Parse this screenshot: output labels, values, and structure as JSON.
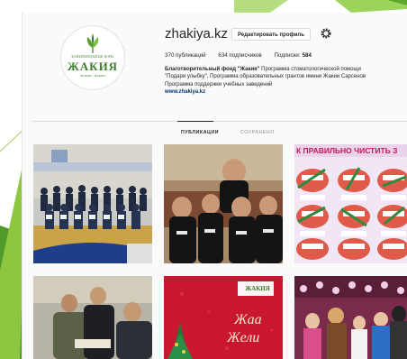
{
  "profile": {
    "username": "zhakiya.kz",
    "edit_button": "Редактировать профиль",
    "stats": {
      "posts": "370 публикаций",
      "followers": "634 подписчиков",
      "following_label": "Подписки:",
      "following_value": "584"
    },
    "bio": {
      "name": "Благотворительный фонд \"Жакия\"",
      "line1": "Программа стоматологической помощи",
      "line2": "\"Подари улыбку\", Программа образовательных грантов имени Жакии Сарсенов",
      "line3": "Программа поддержки учебных заведений",
      "website": "www.zhakiya.kz"
    },
    "logo": {
      "top_text": "ҚАЙЫРЫМДЫЛЫҚ ҚОРЫ",
      "main_text": "ЖАКИЯ",
      "bottom_text": "\"ЖАКИЯ\" \"ЖАҚИЯ\""
    }
  },
  "tabs": [
    {
      "label": "ПУБЛИКАЦИИ",
      "active": true
    },
    {
      "label": "СОХРАНЕНО",
      "active": false
    }
  ],
  "posts": [
    {
      "caption": ""
    },
    {
      "caption": ""
    },
    {
      "caption": "К ПРАВИЛЬНО ЧИСТИТЬ З"
    },
    {
      "caption": ""
    },
    {
      "caption": "ЖАКИЯ",
      "script": "Жаа",
      "script2": "Жели"
    },
    {
      "caption": ""
    }
  ],
  "colors": {
    "accent_green": "#7bc142",
    "link_blue": "#003569",
    "logo_green": "#3f7d2d"
  },
  "icons": [
    "gear-icon",
    "leaf-logo-icon"
  ]
}
